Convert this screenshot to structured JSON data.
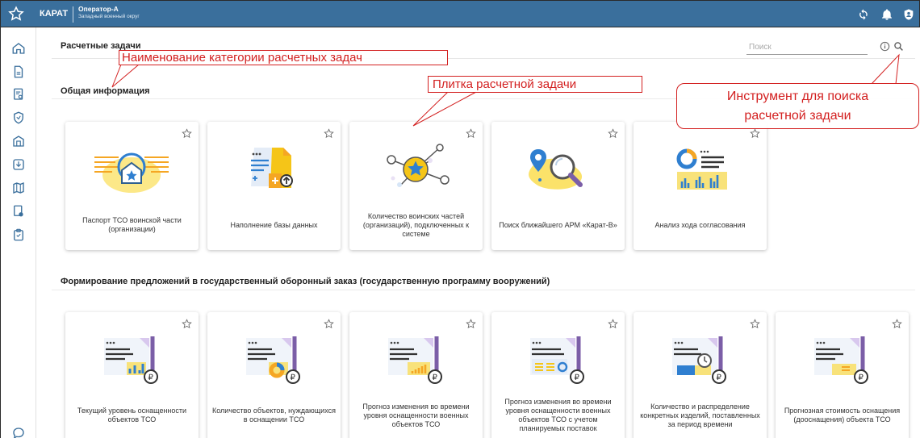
{
  "app": {
    "brand": "КАРАТ",
    "user_name": "Оператор-А",
    "user_org": "Западный военный округ"
  },
  "page": {
    "title": "Расчетные задачи",
    "search_placeholder": "Поиск"
  },
  "sections": [
    {
      "title": "Общая информация",
      "tiles": [
        {
          "label": "Паспорт ТСО воинской части (организации)",
          "icon": "passport-illustration"
        },
        {
          "label": "Наполнение базы данных",
          "icon": "database-fill-illustration"
        },
        {
          "label": "Количество воинских частей (организаций), подключенных к системе",
          "icon": "network-star-illustration"
        },
        {
          "label": "Поиск ближайшего АРМ «Карат-В»",
          "icon": "map-search-illustration"
        },
        {
          "label": "Анализ хода согласования",
          "icon": "analysis-chart-illustration"
        }
      ]
    },
    {
      "title": "Формирование предложений в государственный оборонный заказ (государственную программу вооружений)",
      "tiles": [
        {
          "label": "Текущий уровень оснащенности объектов ТСО",
          "icon": "document-bars-ruble-illustration"
        },
        {
          "label": "Количество объектов, нуждающихся в оснащении ТСО",
          "icon": "document-donut-ruble-illustration"
        },
        {
          "label": "Прогноз изменения во времени уровня оснащенности военных объектов ТСО",
          "icon": "document-growth-ruble-illustration"
        },
        {
          "label": "Прогноз изменения во времени уровня оснащенности военных объектов ТСО с учетом планируемых поставок",
          "icon": "document-forecast-ruble-illustration"
        },
        {
          "label": "Количество и распределение конкретных изделий, поставленных за период времени",
          "icon": "document-clock-ruble-illustration"
        },
        {
          "label": "Прогнозная стоимость оснащения (дооснащения) объекта ТСО",
          "icon": "document-cost-ruble-illustration"
        }
      ]
    }
  ],
  "annotations": {
    "category_name": "Наименование категории расчетных задач",
    "tile": "Плитка расчетной задачи",
    "search_tool_line1": "Инструмент для поиска",
    "search_tool_line2": "расчетной задачи"
  },
  "colors": {
    "topbar": "#3a6f9c",
    "accent_blue": "#2f7fd0",
    "accent_yellow": "#f5c518",
    "accent_purple": "#7b5ea7",
    "annotation_red": "#d32020"
  }
}
